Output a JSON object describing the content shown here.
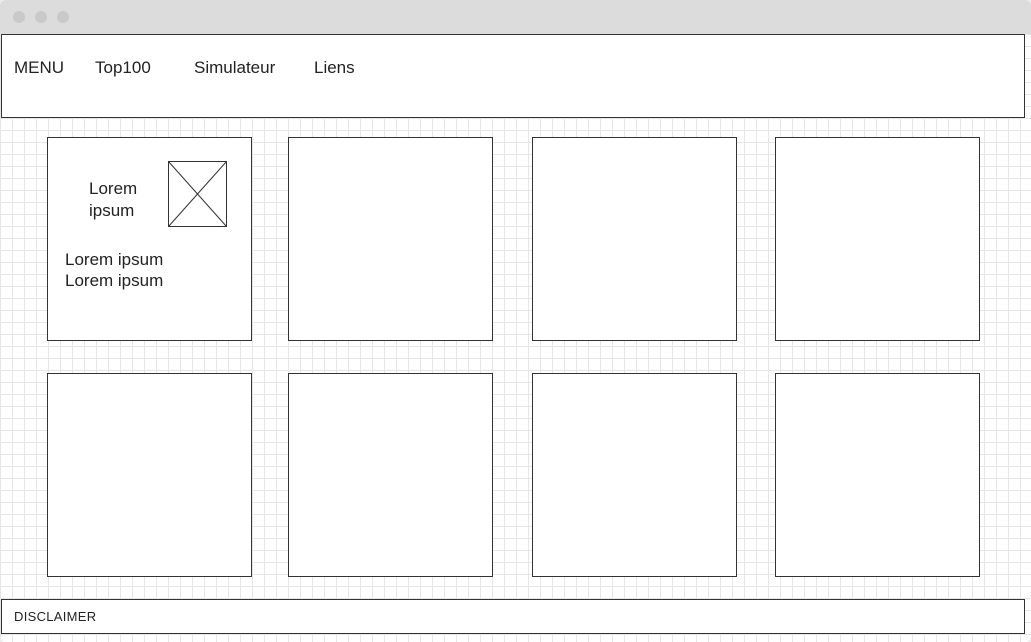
{
  "nav": {
    "menu": "MENU",
    "items": [
      "Top100",
      "Simulateur",
      "Liens"
    ]
  },
  "cards": [
    {
      "title": "Lorem ipsum",
      "text_lines": [
        "Lorem ipsum",
        "Lorem ipsum"
      ],
      "image_icon": "image-placeholder-icon"
    },
    {},
    {},
    {},
    {},
    {},
    {},
    {}
  ],
  "footer": {
    "text": "DISCLAIMER"
  }
}
